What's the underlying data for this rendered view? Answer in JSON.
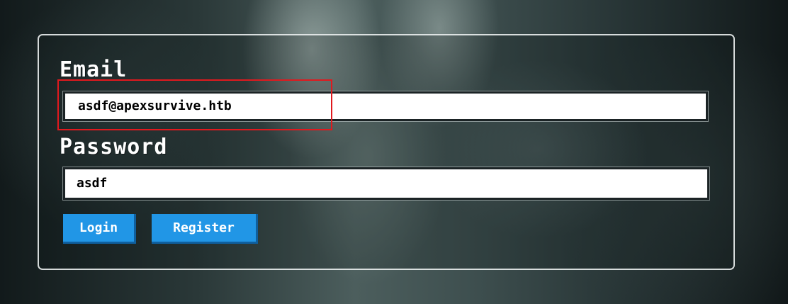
{
  "form": {
    "email_label": "Email",
    "email_value": "asdf@apexsurvive.htb",
    "password_label": "Password",
    "password_value": "asdf",
    "login_label": "Login",
    "register_label": "Register"
  },
  "colors": {
    "button": "#2196e6",
    "highlight": "#e0191e",
    "panel_border": "#ebf0f0"
  }
}
